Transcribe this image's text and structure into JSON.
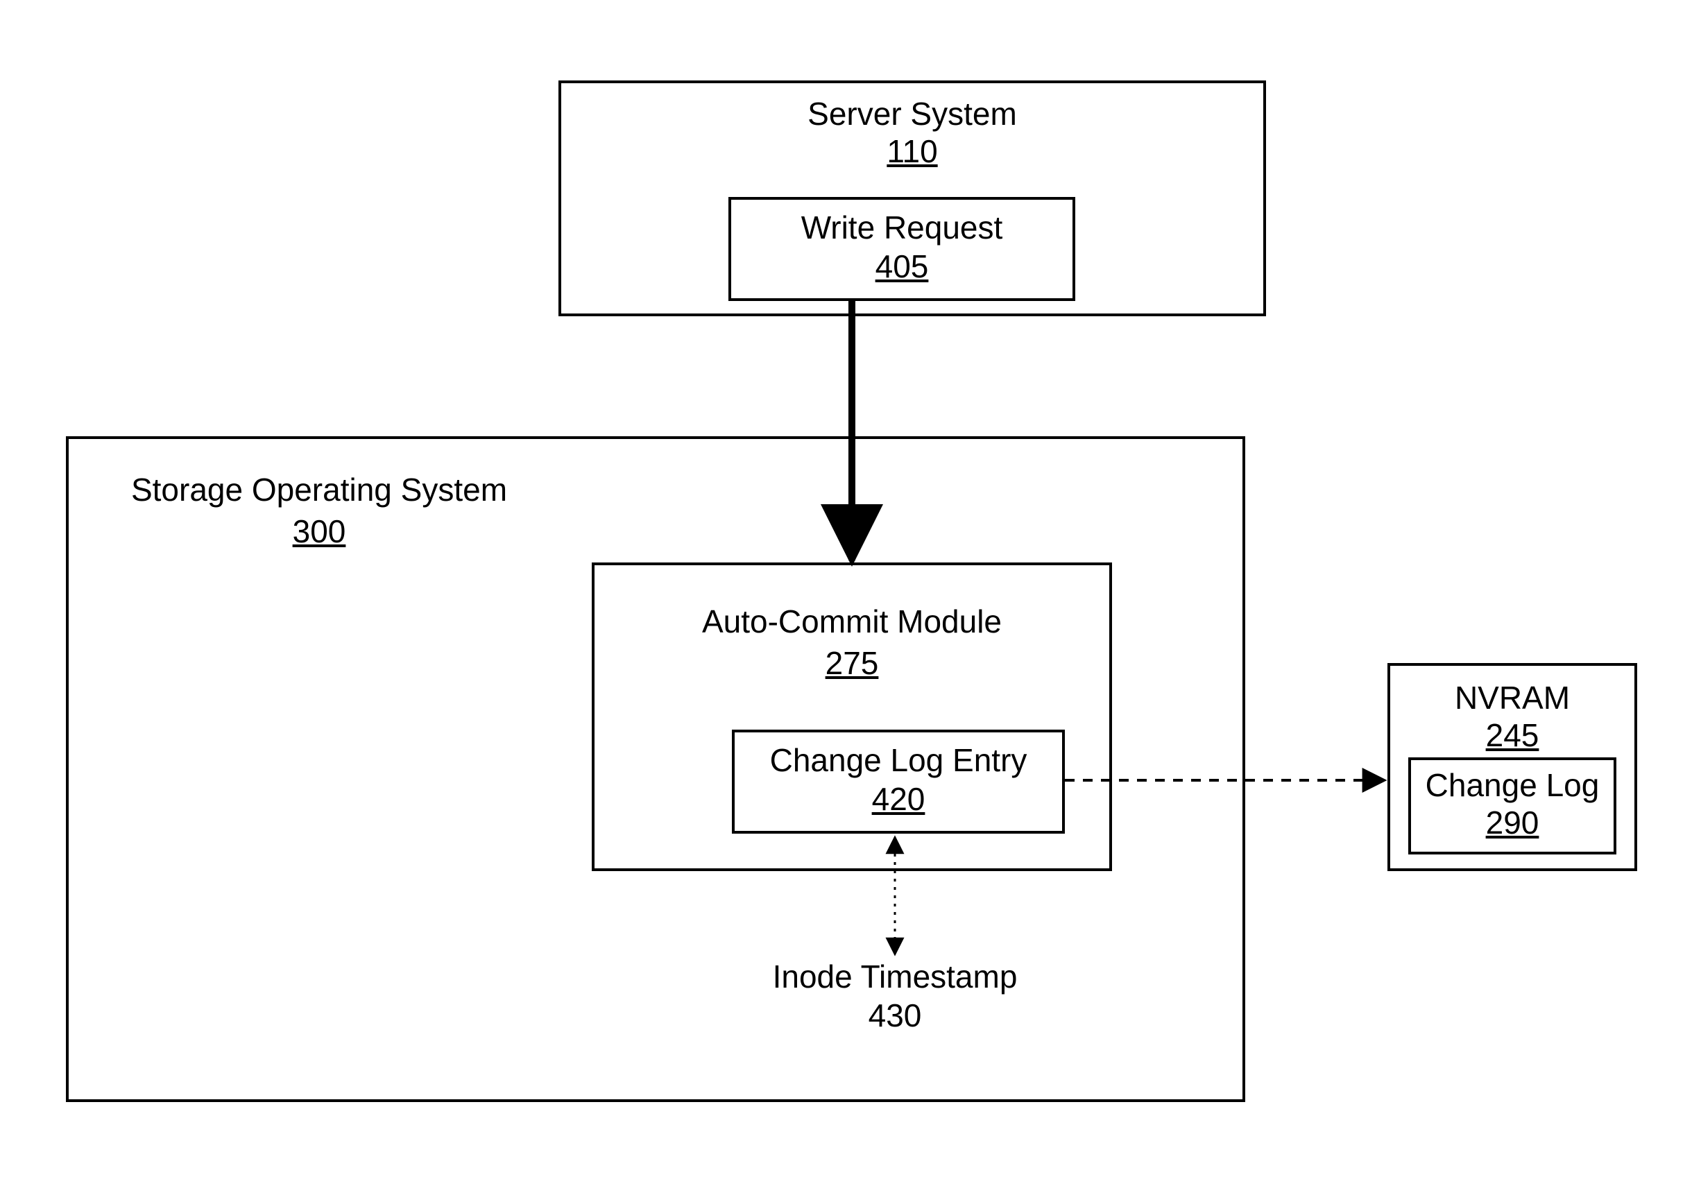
{
  "nodes": {
    "server_system": {
      "title": "Server System",
      "ref": "110"
    },
    "write_request": {
      "title": "Write Request",
      "ref": "405"
    },
    "storage_os": {
      "title": "Storage Operating System",
      "ref": "300"
    },
    "auto_commit": {
      "title": "Auto-Commit Module",
      "ref": "275"
    },
    "change_log_entry": {
      "title": "Change Log Entry",
      "ref": "420"
    },
    "inode_timestamp": {
      "title": "Inode Timestamp",
      "ref": "430"
    },
    "nvram": {
      "title": "NVRAM",
      "ref": "245"
    },
    "change_log": {
      "title": "Change Log",
      "ref": "290"
    }
  }
}
